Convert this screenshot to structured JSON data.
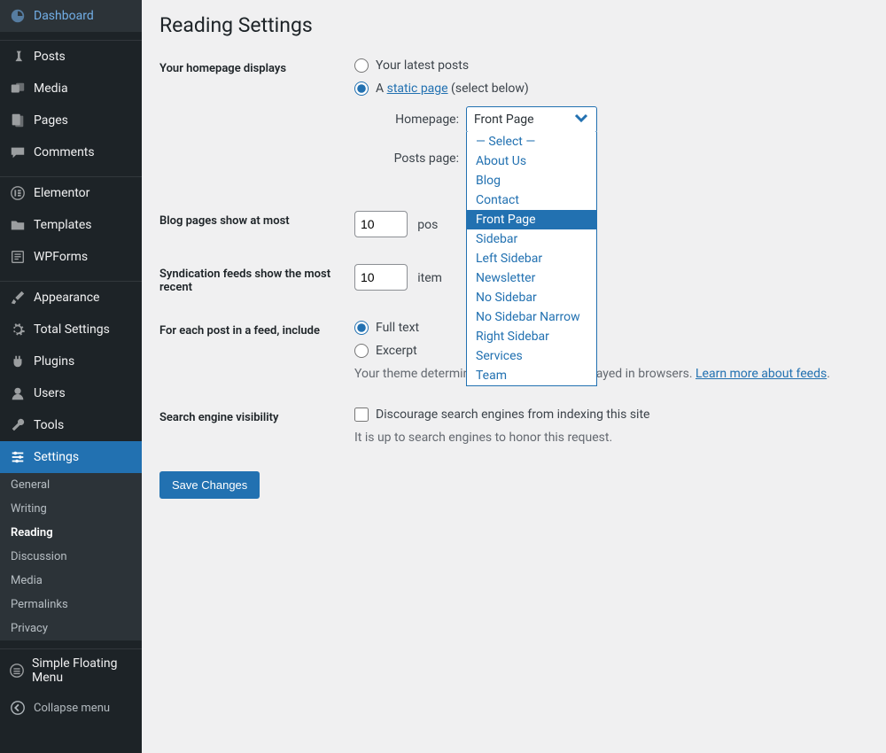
{
  "page_title": "Reading Settings",
  "sidebar": {
    "items": [
      {
        "label": "Dashboard"
      },
      {
        "label": "Posts"
      },
      {
        "label": "Media"
      },
      {
        "label": "Pages"
      },
      {
        "label": "Comments"
      },
      {
        "label": "Elementor"
      },
      {
        "label": "Templates"
      },
      {
        "label": "WPForms"
      },
      {
        "label": "Appearance"
      },
      {
        "label": "Total Settings"
      },
      {
        "label": "Plugins"
      },
      {
        "label": "Users"
      },
      {
        "label": "Tools"
      },
      {
        "label": "Settings"
      }
    ],
    "settings_sub": [
      {
        "label": "General"
      },
      {
        "label": "Writing"
      },
      {
        "label": "Reading"
      },
      {
        "label": "Discussion"
      },
      {
        "label": "Media"
      },
      {
        "label": "Permalinks"
      },
      {
        "label": "Privacy"
      }
    ],
    "sfm_label": "Simple Floating Menu",
    "collapse_label": "Collapse menu"
  },
  "settings": {
    "homepage_displays": {
      "label": "Your homepage displays",
      "opt_latest": "Your latest posts",
      "opt_static_prefix": "A ",
      "opt_static_link": "static page",
      "opt_static_suffix": " (select below)",
      "homepage_label": "Homepage:",
      "posts_page_label": "Posts page:",
      "homepage_value": "Front Page",
      "posts_page_value": "",
      "dropdown_options": [
        "— Select —",
        "About Us",
        "Blog",
        "Contact",
        "Front Page",
        "Sidebar",
        "Left Sidebar",
        "Newsletter",
        "No Sidebar",
        "No Sidebar Narrow",
        "Right Sidebar",
        "Services",
        "Team"
      ]
    },
    "blog_pages": {
      "label": "Blog pages show at most",
      "value": "10",
      "suffix": "pos"
    },
    "syndication": {
      "label": "Syndication feeds show the most recent",
      "value": "10",
      "suffix": "item"
    },
    "feed_include": {
      "label": "For each post in a feed, include",
      "opt_full": "Full text",
      "opt_excerpt": "Excerpt",
      "desc_prefix": "Your theme determines how content is displayed in browsers. ",
      "desc_link": "Learn more about feeds",
      "desc_suffix": "."
    },
    "search_visibility": {
      "label": "Search engine visibility",
      "checkbox_label": "Discourage search engines from indexing this site",
      "desc": "It is up to search engines to honor this request."
    },
    "save_label": "Save Changes"
  }
}
